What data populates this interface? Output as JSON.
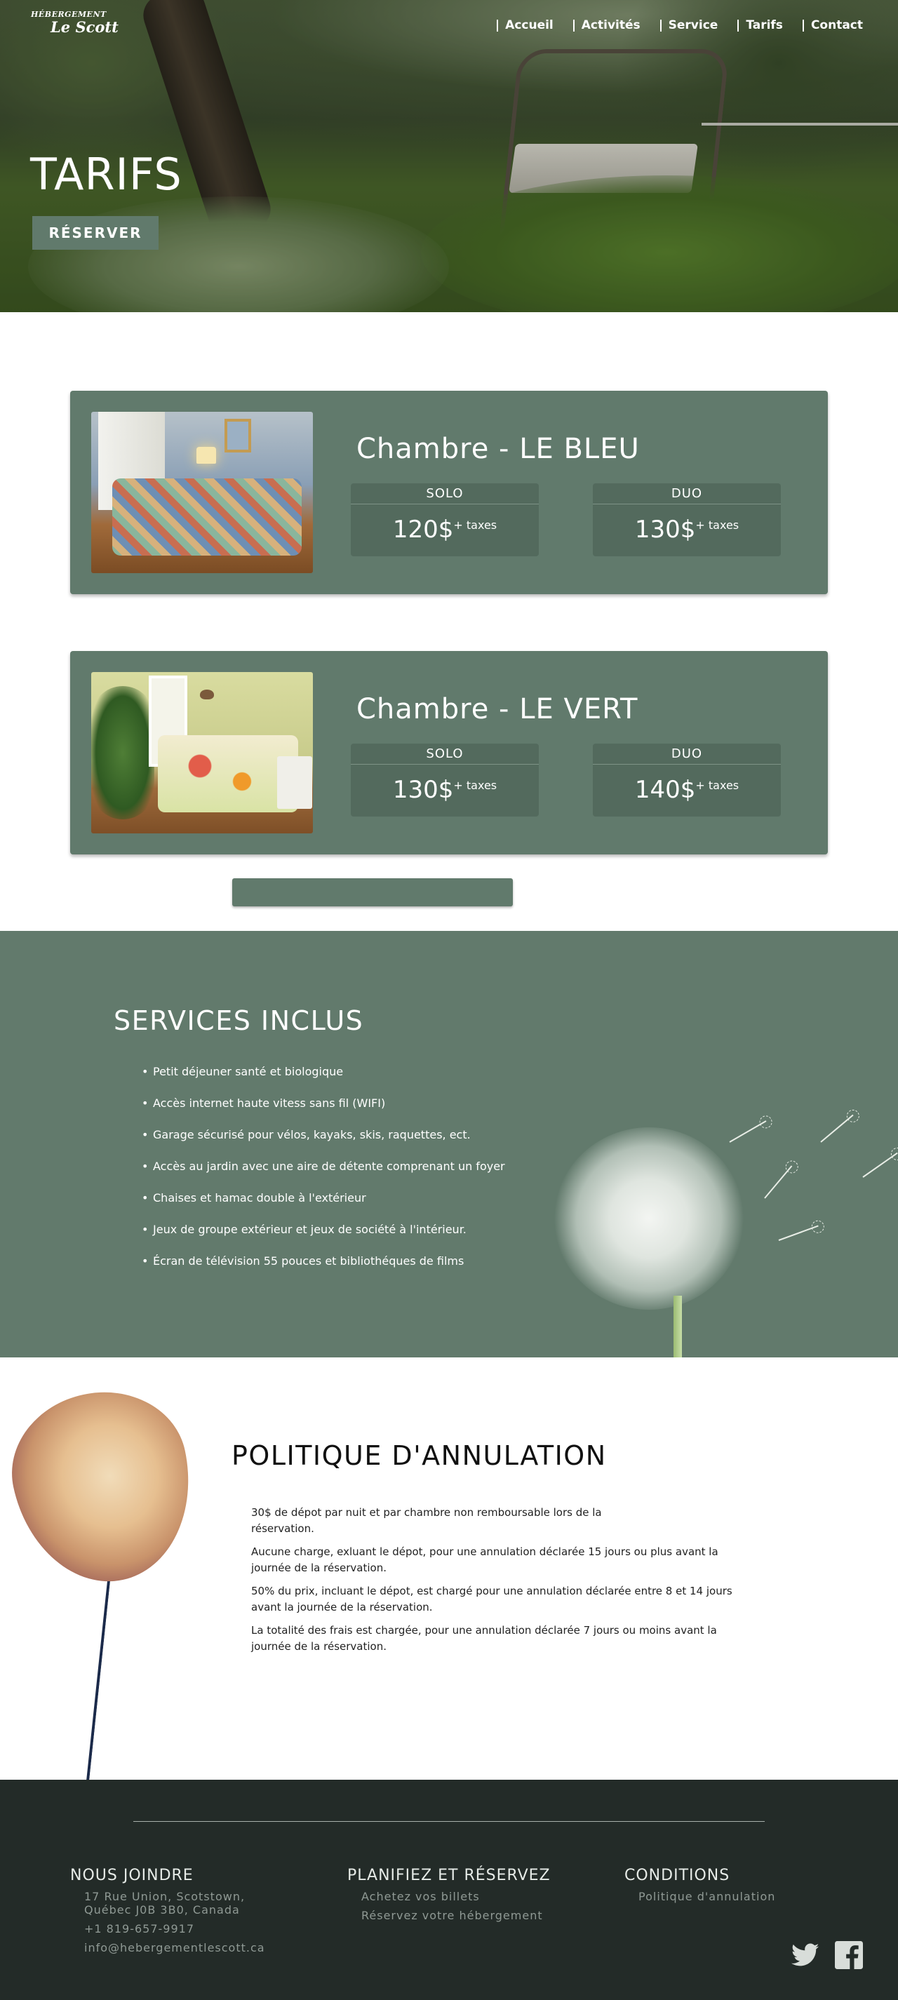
{
  "brand": {
    "logo_top": "HÉBERGEMENT",
    "logo_bottom": "Le Scott"
  },
  "nav": {
    "items": [
      "Accueil",
      "Activités",
      "Service",
      "Tarifs",
      "Contact"
    ]
  },
  "hero": {
    "title": "TARIFS",
    "cta_label": "RÉSERVER"
  },
  "rooms": [
    {
      "name": "Chambre - LE BLEU",
      "solo_label": "SOLO",
      "solo_price": "120$",
      "duo_label": "DUO",
      "duo_price": "130$",
      "tax_note": "+ taxes",
      "photo_icon": "bedroom-blue-photo"
    },
    {
      "name": "Chambre - LE VERT",
      "solo_label": "SOLO",
      "solo_price": "130$",
      "duo_label": "DUO",
      "duo_price": "140$",
      "tax_note": "+ taxes",
      "photo_icon": "bedroom-green-photo"
    }
  ],
  "services": {
    "title": "SERVICES INCLUS",
    "items": [
      "Petit déjeuner santé et biologique",
      "Accès internet haute vitess sans fil (WIFI)",
      "Garage sécurisé pour vélos, kayaks, skis, raquettes, ect.",
      "Accès au jardin avec une aire de détente comprenant un foyer",
      "Chaises et hamac double à l'extérieur",
      "Jeux de groupe extérieur et jeux de société à l'intérieur.",
      "Écran de télévision 55 pouces et bibliothéques de films"
    ]
  },
  "policy": {
    "title": "POLITIQUE D'ANNULATION",
    "paragraphs": [
      "30$ de dépot par nuit et par chambre non remboursable lors de la réservation.",
      "Aucune charge, exluant le dépot, pour une annulation déclarée 15 jours ou plus avant la journée de la réservation.",
      "50% du prix, incluant le dépot, est chargé pour une annulation déclarée entre 8 et 14 jours avant la journée de la réservation.",
      "La totalité des frais est chargée, pour une annulation déclarée 7 jours ou moins avant la journée de la réservation."
    ]
  },
  "footer": {
    "contact": {
      "title": "NOUS JOINDRE",
      "address_line1": "17 Rue Union, Scotstown,",
      "address_line2": "Québec J0B 3B0, Canada",
      "phone": "+1 819-657-9917",
      "email": "info@hebergementlescott.ca"
    },
    "plan": {
      "title": "PLANIFIEZ ET RÉSERVEZ",
      "links": [
        "Achetez vos billets",
        "Réservez votre hébergement"
      ]
    },
    "conditions": {
      "title": "CONDITIONS",
      "links": [
        "Politique d'annulation"
      ]
    },
    "social": [
      "twitter-icon",
      "facebook-icon"
    ]
  },
  "colors": {
    "accent": "#617a6c",
    "accent_dark": "#536a5d",
    "footer_bg": "#232b28"
  }
}
